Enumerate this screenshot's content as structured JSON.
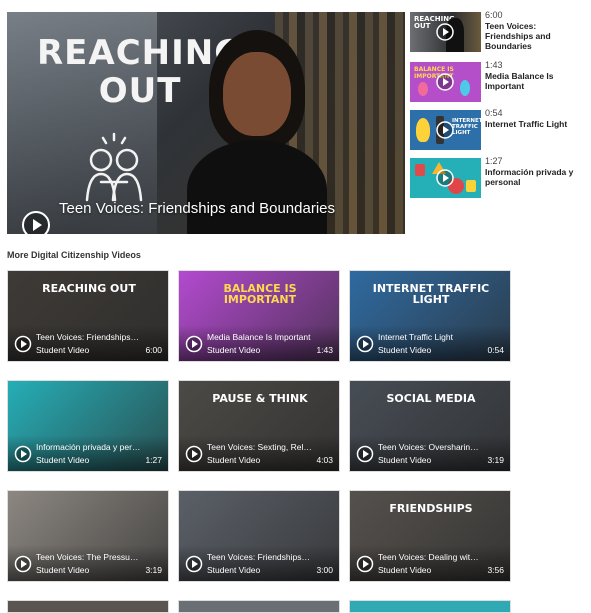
{
  "hero": {
    "title": "Teen Voices: Friendships and Boundaries",
    "art_title_line1": "REACHING",
    "art_title_line2": "OUT",
    "play_icon": "play-circle-icon"
  },
  "playlist": [
    {
      "duration": "6:00",
      "title": "Teen Voices: Friendships and Boundaries",
      "theme": "#3b3b3b"
    },
    {
      "duration": "1:43",
      "title": "Media Balance Is Important",
      "theme": "#b44fc9"
    },
    {
      "duration": "0:54",
      "title": "Internet Traffic Light",
      "theme": "#2d6fa8"
    },
    {
      "duration": "1:27",
      "title": "Información privada y personal",
      "theme": "#25b0b7"
    }
  ],
  "section_title": "More Digital Citizenship Videos",
  "cards": [
    {
      "title": "Teen Voices: Friendships and Boundaries",
      "subtitle": "Student Video",
      "duration": "6:00",
      "art_text": "REACHING OUT",
      "bg": "#3e3a36"
    },
    {
      "title": "Media Balance Is Important",
      "subtitle": "Student Video",
      "duration": "1:43",
      "art_text": "BALANCE IS IMPORTANT",
      "bg": "#b34ad0"
    },
    {
      "title": "Internet Traffic Light",
      "subtitle": "Student Video",
      "duration": "0:54",
      "art_text": "INTERNET TRAFFIC LIGHT",
      "bg": "#2f6aa0"
    },
    {
      "title": "Información privada y personal",
      "subtitle": "Student Video",
      "duration": "1:27",
      "art_text": "",
      "bg": "#26aeb6"
    },
    {
      "title": "Teen Voices: Sexting, Relationships, and Risks",
      "subtitle": "Student Video",
      "duration": "4:03",
      "art_text": "PAUSE & THINK",
      "bg": "#4c4a46"
    },
    {
      "title": "Teen Voices: Oversharing and Your Digital Footprint",
      "subtitle": "Student Video",
      "duration": "3:19",
      "art_text": "SOCIAL MEDIA",
      "bg": "#474d55"
    },
    {
      "title": "Teen Voices: The Pressure to Be Perfect",
      "subtitle": "Student Video",
      "duration": "3:19",
      "art_text": "",
      "bg": "#8c8781"
    },
    {
      "title": "Teen Voices: Friendships and Connection",
      "subtitle": "Student Video",
      "duration": "3:00",
      "art_text": "",
      "bg": "#5b6068"
    },
    {
      "title": "Teen Voices: Dealing with Digital Drama",
      "subtitle": "Student Video",
      "duration": "3:56",
      "art_text": "FRIENDSHIPS",
      "bg": "#55514d"
    }
  ]
}
